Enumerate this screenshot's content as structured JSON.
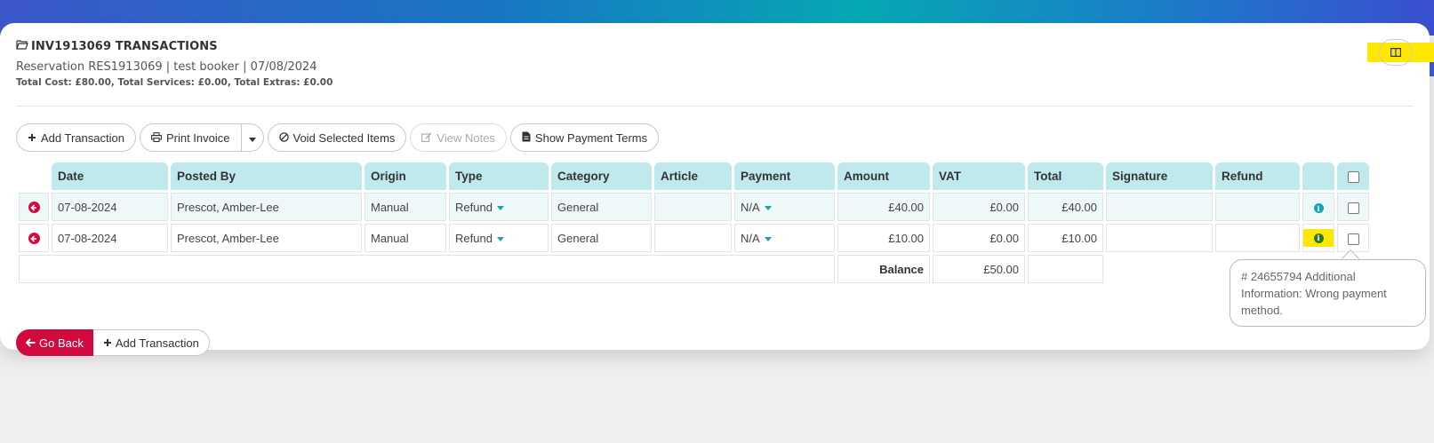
{
  "header": {
    "title": "INV1913069 TRANSACTIONS",
    "subline": "Reservation RES1913069 | test booker | 07/08/2024",
    "totals": "Total Cost: £80.00, Total Services: £0.00, Total Extras: £0.00"
  },
  "toolbar": {
    "add_transaction": "Add Transaction",
    "print_invoice": "Print Invoice",
    "void_selected": "Void Selected Items",
    "view_notes": "View Notes",
    "show_payment_terms": "Show Payment Terms"
  },
  "table": {
    "headers": [
      "Date",
      "Posted By",
      "Origin",
      "Type",
      "Category",
      "Article",
      "Payment",
      "Amount",
      "VAT",
      "Total",
      "Signature",
      "Refund"
    ],
    "rows": [
      {
        "date": "07-08-2024",
        "posted_by": "Prescot, Amber-Lee",
        "origin": "Manual",
        "type": "Refund",
        "category": "General",
        "article": "",
        "payment": "N/A",
        "amount": "£40.00",
        "vat": "£0.00",
        "total": "£40.00",
        "signature": "",
        "refund": ""
      },
      {
        "date": "07-08-2024",
        "posted_by": "Prescot, Amber-Lee",
        "origin": "Manual",
        "type": "Refund",
        "category": "General",
        "article": "",
        "payment": "N/A",
        "amount": "£10.00",
        "vat": "£0.00",
        "total": "£10.00",
        "signature": "",
        "refund": ""
      }
    ],
    "balance_label": "Balance",
    "balance_value": "£50.00"
  },
  "tooltip": {
    "text": "# 24655794 Additional Information: Wrong payment method."
  },
  "footer": {
    "go_back": "Go Back",
    "add_transaction": "Add Transaction"
  },
  "colors": {
    "accent": "#18a3b3",
    "header_cell": "#bfe9ec",
    "danger": "#d10a40",
    "highlight": "#ffe800"
  },
  "icons": {
    "title": "folder-open-icon",
    "columns_toggle": "columns-icon",
    "add": "plus-icon",
    "print": "print-icon",
    "dropdown": "caret-down-icon",
    "void": "ban-icon",
    "notes": "edit-icon",
    "terms": "file-icon",
    "row_action": "arrow-circle-left-icon",
    "info": "info-circle-icon"
  }
}
